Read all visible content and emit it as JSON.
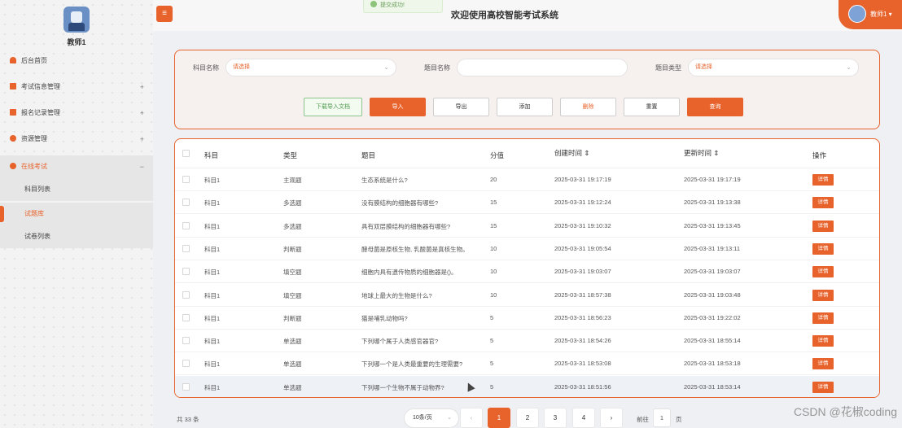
{
  "sidebar": {
    "username": "教师1",
    "menu": [
      {
        "label": "后台首页",
        "icon": "home-icon"
      },
      {
        "label": "考试信息管理",
        "icon": "grid-icon",
        "expand": "+"
      },
      {
        "label": "报名记录管理",
        "icon": "grid-icon",
        "expand": "+"
      },
      {
        "label": "资源管理",
        "icon": "database-icon",
        "expand": "+"
      },
      {
        "label": "在线考试",
        "icon": "database-icon",
        "expand": "−"
      }
    ],
    "submenu": [
      "科目列表",
      "试题库",
      "试卷列表"
    ]
  },
  "header": {
    "title": "欢迎使用高校智能考试系统",
    "toast": "提交成功!",
    "user_label": "教师1",
    "menu_icon": "≡"
  },
  "search": {
    "subject_label": "科目名称",
    "subject_value": "请选择",
    "question_label": "题目名称",
    "question_value": "",
    "type_label": "题目类型",
    "type_value": "请选择",
    "buttons": {
      "download": "下载导入文档",
      "import": "导入",
      "export": "导出",
      "add": "添加",
      "delete": "删除",
      "reset": "重置",
      "query": "查询"
    }
  },
  "table": {
    "headers": [
      "科目",
      "类型",
      "题目",
      "分值",
      "创建时间 ⇕",
      "更新时间 ⇕",
      "操作"
    ],
    "detail_label": "详情",
    "rows": [
      [
        "科目1",
        "主观题",
        "生态系统是什么?",
        "20",
        "2025-03-31 19:17:19",
        "2025-03-31 19:17:19"
      ],
      [
        "科目1",
        "多选题",
        "没有膜结构的细胞器有哪些?",
        "15",
        "2025-03-31 19:12:24",
        "2025-03-31 19:13:38"
      ],
      [
        "科目1",
        "多选题",
        "具有双层膜结构的细胞器有哪些?",
        "15",
        "2025-03-31 19:10:32",
        "2025-03-31 19:13:45"
      ],
      [
        "科目1",
        "判断题",
        "酵母菌是原核生物, 乳酸菌是真核生物。",
        "10",
        "2025-03-31 19:05:54",
        "2025-03-31 19:13:11"
      ],
      [
        "科目1",
        "填空题",
        "细胞内具有遗传物质的细胞器是()。",
        "10",
        "2025-03-31 19:03:07",
        "2025-03-31 19:03:07"
      ],
      [
        "科目1",
        "填空题",
        "地球上最大的生物是什么?",
        "10",
        "2025-03-31 18:57:38",
        "2025-03-31 19:03:48"
      ],
      [
        "科目1",
        "判断题",
        "猫是哺乳动物吗?",
        "5",
        "2025-03-31 18:56:23",
        "2025-03-31 19:22:02"
      ],
      [
        "科目1",
        "单选题",
        "下列哪个属于人类感官器官?",
        "5",
        "2025-03-31 18:54:26",
        "2025-03-31 18:55:14"
      ],
      [
        "科目1",
        "单选题",
        "下列哪一个是人类最重要的生理需要?",
        "5",
        "2025-03-31 18:53:08",
        "2025-03-31 18:53:18"
      ],
      [
        "科目1",
        "单选题",
        "下列哪一个生物不属于动物界?",
        "5",
        "2025-03-31 18:51:56",
        "2025-03-31 18:53:14"
      ]
    ]
  },
  "pagination": {
    "total": "共 33 条",
    "page_size": "10条/页",
    "pages": [
      "1",
      "2",
      "3",
      "4"
    ],
    "prev": "‹",
    "next": "›",
    "goto_prefix": "前往",
    "goto_value": "1",
    "goto_suffix": "页"
  },
  "watermark": "CSDN @花椒coding",
  "colors": {
    "accent": "#e8622b",
    "success": "#8cc57a"
  }
}
